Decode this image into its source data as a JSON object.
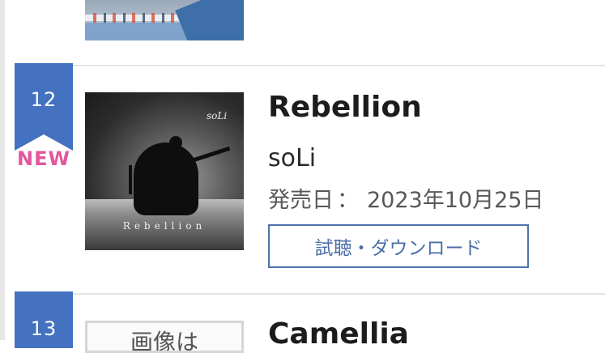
{
  "previous_entry": {
    "thumbnail_icon": "concert-photo-thumbnail"
  },
  "entry_12": {
    "rank": "12",
    "badge": "NEW",
    "title": "Rebellion",
    "artist": "soLi",
    "release_label": "発売日",
    "release_separator": "：",
    "release_date": "2023年10月25日",
    "listen_button": "試聴・ダウンロード",
    "cover": {
      "logo_text": "soLi",
      "title_text": "Rebellion"
    }
  },
  "entry_13": {
    "rank": "13",
    "title": "Camellia",
    "thumbnail_text": "画像は"
  },
  "colors": {
    "rank_ribbon": "#4472c0",
    "new_badge": "#e1579d",
    "button_border": "#4f73a8",
    "button_text": "#4a6ea6"
  }
}
